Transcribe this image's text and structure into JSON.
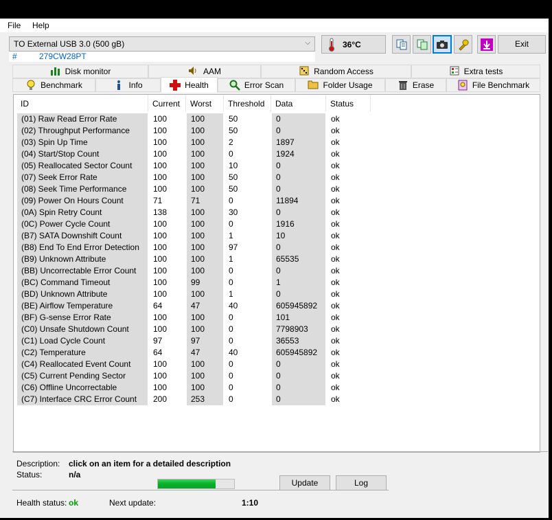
{
  "menu": {
    "file": "File",
    "help": "Help"
  },
  "drive": {
    "selected": "TO External USB 3.0 (500 gB)",
    "serial_prefix": "#",
    "serial": "279CW28PT",
    "temperature": "36°C"
  },
  "toolbar": {
    "exit_label": "Exit"
  },
  "tabs_top": [
    {
      "label": "Disk monitor",
      "icon": "chart-icon"
    },
    {
      "label": "AAM",
      "icon": "speaker-icon"
    },
    {
      "label": "Random Access",
      "icon": "dice-icon"
    },
    {
      "label": "Extra tests",
      "icon": "checklist-icon"
    }
  ],
  "tabs_bottom": [
    {
      "label": "Benchmark",
      "icon": "lightbulb-icon"
    },
    {
      "label": "Info",
      "icon": "info-icon"
    },
    {
      "label": "Health",
      "icon": "red-cross-icon"
    },
    {
      "label": "Error Scan",
      "icon": "magnifier-icon"
    },
    {
      "label": "Folder Usage",
      "icon": "folder-icon"
    },
    {
      "label": "Erase",
      "icon": "trash-icon"
    },
    {
      "label": "File Benchmark",
      "icon": "file-benchmark-icon"
    }
  ],
  "table": {
    "headers": [
      "ID",
      "Current",
      "Worst",
      "Threshold",
      "Data",
      "Status"
    ],
    "rows": [
      [
        "(01) Raw Read Error Rate",
        "100",
        "100",
        "50",
        "0",
        "ok"
      ],
      [
        "(02) Throughput Performance",
        "100",
        "100",
        "50",
        "0",
        "ok"
      ],
      [
        "(03) Spin Up Time",
        "100",
        "100",
        "2",
        "1897",
        "ok"
      ],
      [
        "(04) Start/Stop Count",
        "100",
        "100",
        "0",
        "1924",
        "ok"
      ],
      [
        "(05) Reallocated Sector Count",
        "100",
        "100",
        "10",
        "0",
        "ok"
      ],
      [
        "(07) Seek Error Rate",
        "100",
        "100",
        "50",
        "0",
        "ok"
      ],
      [
        "(08) Seek Time Performance",
        "100",
        "100",
        "50",
        "0",
        "ok"
      ],
      [
        "(09) Power On Hours Count",
        "71",
        "71",
        "0",
        "11894",
        "ok"
      ],
      [
        "(0A) Spin Retry Count",
        "138",
        "100",
        "30",
        "0",
        "ok"
      ],
      [
        "(0C) Power Cycle Count",
        "100",
        "100",
        "0",
        "1916",
        "ok"
      ],
      [
        "(B7) SATA Downshift Count",
        "100",
        "100",
        "1",
        "10",
        "ok"
      ],
      [
        "(B8) End To End Error Detection",
        "100",
        "100",
        "97",
        "0",
        "ok"
      ],
      [
        "(B9) Unknown Attribute",
        "100",
        "100",
        "1",
        "65535",
        "ok"
      ],
      [
        "(BB) Uncorrectable Error Count",
        "100",
        "100",
        "0",
        "0",
        "ok"
      ],
      [
        "(BC) Command Timeout",
        "100",
        "99",
        "0",
        "1",
        "ok"
      ],
      [
        "(BD) Unknown Attribute",
        "100",
        "100",
        "1",
        "0",
        "ok"
      ],
      [
        "(BE) Airflow Temperature",
        "64",
        "47",
        "40",
        "605945892",
        "ok"
      ],
      [
        "(BF) G-sense Error Rate",
        "100",
        "100",
        "0",
        "101",
        "ok"
      ],
      [
        "(C0) Unsafe Shutdown Count",
        "100",
        "100",
        "0",
        "7798903",
        "ok"
      ],
      [
        "(C1) Load Cycle Count",
        "97",
        "97",
        "0",
        "36553",
        "ok"
      ],
      [
        "(C2) Temperature",
        "64",
        "47",
        "40",
        "605945892",
        "ok"
      ],
      [
        "(C4) Reallocated Event Count",
        "100",
        "100",
        "0",
        "0",
        "ok"
      ],
      [
        "(C5) Current Pending Sector",
        "100",
        "100",
        "0",
        "0",
        "ok"
      ],
      [
        "(C6) Offline Uncorrectable",
        "100",
        "100",
        "0",
        "0",
        "ok"
      ],
      [
        "(C7) Interface CRC Error Count",
        "200",
        "253",
        "0",
        "0",
        "ok"
      ]
    ]
  },
  "details": {
    "description_label": "Description:",
    "description_value": "click on an item for a detailed description",
    "status_label": "Status:",
    "status_value": "n/a"
  },
  "footer": {
    "health_label": "Health status:",
    "health_value": "ok",
    "next_update_label": "Next update:",
    "countdown": "1:10",
    "progress_fraction": 0.76,
    "update_label": "Update",
    "log_label": "Log"
  },
  "colors": {
    "ok_green": "#00a000",
    "serial_blue": "#0066cc",
    "accent": "#0078d7"
  }
}
